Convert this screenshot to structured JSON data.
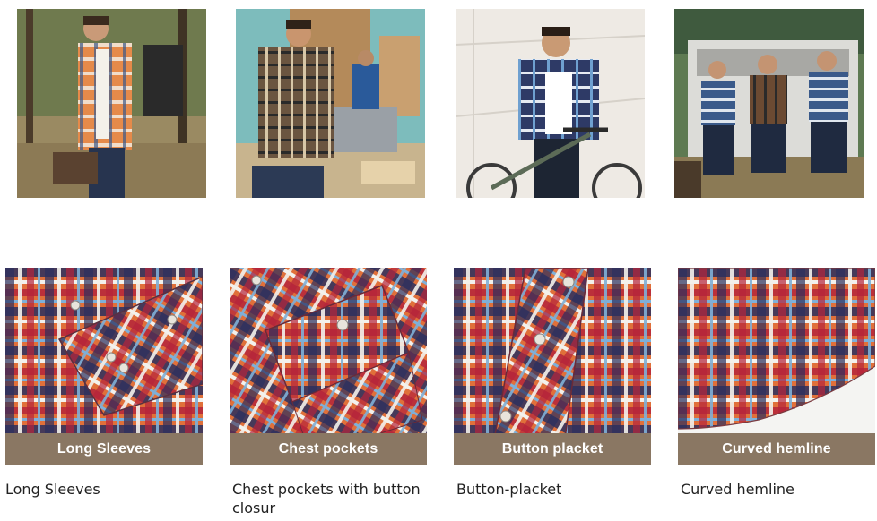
{
  "photos": [
    {
      "scene": "man-walking-woods",
      "alt": ""
    },
    {
      "scene": "man-woodworking",
      "alt": ""
    },
    {
      "scene": "man-with-bicycle",
      "alt": ""
    },
    {
      "scene": "three-men-on-truck",
      "alt": ""
    }
  ],
  "features": [
    {
      "band_label": "Long Sleeves",
      "caption": "Long Sleeves"
    },
    {
      "band_label": "Chest pockets",
      "caption": "Chest pockets with button closur"
    },
    {
      "band_label": "Button placket",
      "caption": "Button-placket"
    },
    {
      "band_label": "Curved hemline",
      "caption": "Curved hemline"
    }
  ],
  "colors": {
    "band": "#8a7763",
    "plaid_navy": "#2b2f5e",
    "plaid_red": "#b5243a",
    "plaid_orange": "#e0703a",
    "plaid_white": "#f3f1ec",
    "plaid_sky": "#7fb0d8"
  }
}
